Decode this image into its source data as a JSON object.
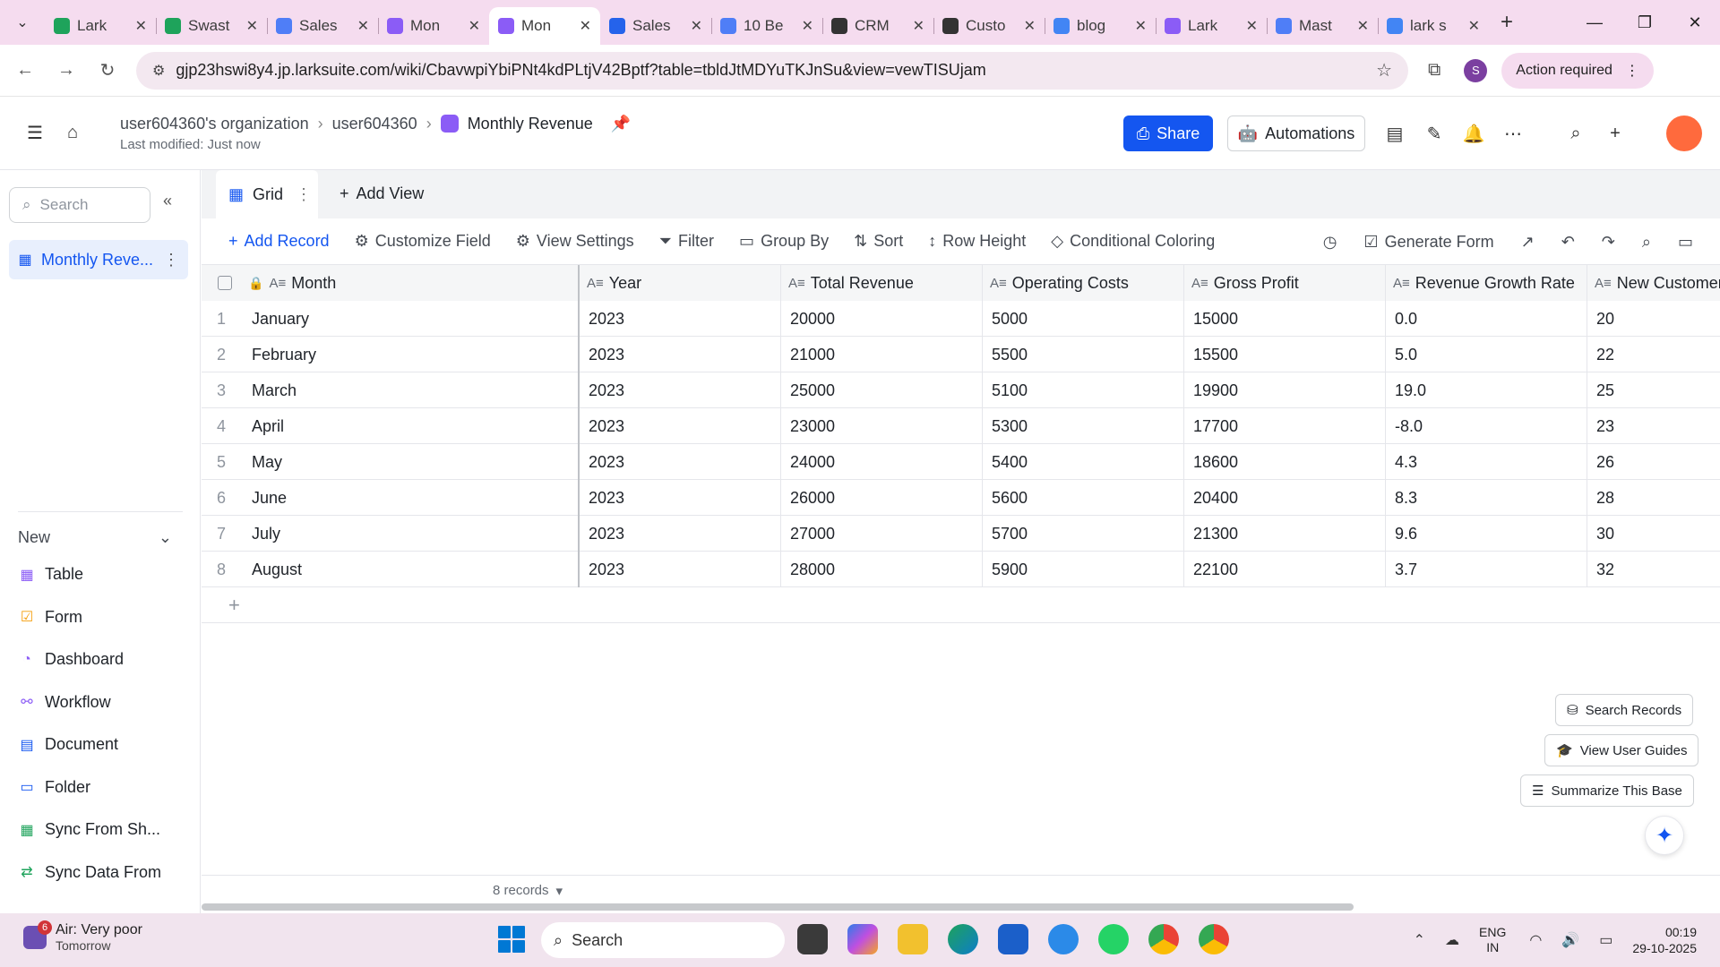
{
  "browser": {
    "tabs": [
      {
        "label": "Lark",
        "icon_color": "#1ea35b",
        "active": false
      },
      {
        "label": "Swast",
        "icon_color": "#1ea35b",
        "active": false
      },
      {
        "label": "Sales",
        "icon_color": "#4f7ef7",
        "active": false
      },
      {
        "label": "Mon",
        "icon_color": "#8b5cf6",
        "active": false
      },
      {
        "label": "Mon",
        "icon_color": "#8b5cf6",
        "active": true
      },
      {
        "label": "Sales",
        "icon_color": "#2563eb",
        "active": false
      },
      {
        "label": "10 Be",
        "icon_color": "#4f7ef7",
        "active": false
      },
      {
        "label": "CRM",
        "icon_color": "#333333",
        "active": false
      },
      {
        "label": "Custo",
        "icon_color": "#333333",
        "active": false
      },
      {
        "label": "blog",
        "icon_color": "#4285f4",
        "active": false
      },
      {
        "label": "Lark",
        "icon_color": "#8b5cf6",
        "active": false
      },
      {
        "label": "Mast",
        "icon_color": "#4f7ef7",
        "active": false
      },
      {
        "label": "lark s",
        "icon_color": "#4285f4",
        "active": false
      }
    ],
    "url": "gjp23hswi8y4.jp.larksuite.com/wiki/CbavwpiYbiPNt4kdPLtjV42Bptf?table=tbldJtMDYuTKJnSu&view=vewTISUjam",
    "profile_initial": "S",
    "action_required": "Action required"
  },
  "header": {
    "crumb_org": "user604360's organization",
    "crumb_user": "user604360",
    "title": "Monthly Revenue",
    "last_modified": "Last modified: Just now",
    "share_label": "Share",
    "automations_label": "Automations"
  },
  "sidebar": {
    "search_placeholder": "Search",
    "table_item": "Monthly Reve...",
    "new_label": "New",
    "items": [
      {
        "label": "Table",
        "icon": "table-icon",
        "color": "#8b5cf6"
      },
      {
        "label": "Form",
        "icon": "form-icon",
        "color": "#f59e0b"
      },
      {
        "label": "Dashboard",
        "icon": "dashboard-icon",
        "color": "#8b5cf6"
      },
      {
        "label": "Workflow",
        "icon": "workflow-icon",
        "color": "#8b5cf6"
      },
      {
        "label": "Document",
        "icon": "document-icon",
        "color": "#1456f0"
      },
      {
        "label": "Folder",
        "icon": "folder-icon",
        "color": "#1456f0"
      },
      {
        "label": "Sync From Sh...",
        "icon": "sync-sheet-icon",
        "color": "#1ea35b"
      },
      {
        "label": "Sync Data From",
        "icon": "sync-data-icon",
        "color": "#1ea35b"
      }
    ]
  },
  "views": {
    "grid_label": "Grid",
    "add_view_label": "Add View"
  },
  "toolbar": {
    "add_record": "Add Record",
    "customize_field": "Customize Field",
    "view_settings": "View Settings",
    "filter": "Filter",
    "group_by": "Group By",
    "sort": "Sort",
    "row_height": "Row Height",
    "conditional_coloring": "Conditional Coloring",
    "generate_form": "Generate Form"
  },
  "table": {
    "columns": [
      "Month",
      "Year",
      "Total Revenue",
      "Operating Costs",
      "Gross Profit",
      "Revenue Growth Rate",
      "New Customers"
    ],
    "rows": [
      [
        "1",
        "January",
        "2023",
        "20000",
        "5000",
        "15000",
        "0.0",
        "20"
      ],
      [
        "2",
        "February",
        "2023",
        "21000",
        "5500",
        "15500",
        "5.0",
        "22"
      ],
      [
        "3",
        "March",
        "2023",
        "25000",
        "5100",
        "19900",
        "19.0",
        "25"
      ],
      [
        "4",
        "April",
        "2023",
        "23000",
        "5300",
        "17700",
        "-8.0",
        "23"
      ],
      [
        "5",
        "May",
        "2023",
        "24000",
        "5400",
        "18600",
        "4.3",
        "26"
      ],
      [
        "6",
        "June",
        "2023",
        "26000",
        "5600",
        "20400",
        "8.3",
        "28"
      ],
      [
        "7",
        "July",
        "2023",
        "27000",
        "5700",
        "21300",
        "9.6",
        "30"
      ],
      [
        "8",
        "August",
        "2023",
        "28000",
        "5900",
        "22100",
        "3.7",
        "32"
      ]
    ],
    "record_count": "8 records"
  },
  "floating": {
    "search_records": "Search Records",
    "view_user_guides": "View User Guides",
    "summarize_base": "Summarize This Base"
  },
  "taskbar": {
    "weather_title": "Air: Very poor",
    "weather_sub": "Tomorrow",
    "weather_badge": "6",
    "search_label": "Search",
    "lang1": "ENG",
    "lang2": "IN",
    "time": "00:19",
    "date": "29-10-2025"
  }
}
